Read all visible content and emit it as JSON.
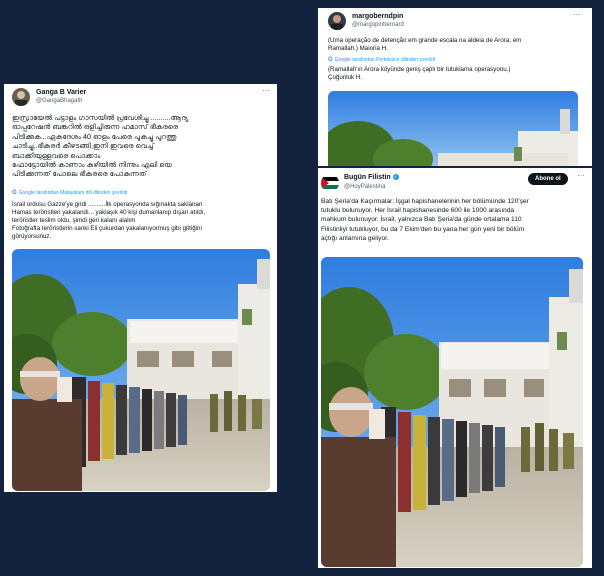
{
  "card_left": {
    "display_name": "Ganga B Varier",
    "handle": "@GangaBhagath",
    "more_icon": "more-icon",
    "tweet_text": "ഇസ്രായേൽ പട്ടാളം ഗാസയിൽ പ്രവേശിച്ചു ..........ആദ്യ\nഓപ്പറേഷൻ ബങ്കറിൽ ഒളിച്ചിരുന്ന ഹമാസ് ഭീകരരെ\nപിടിക്കുക...ഏകദേശം 40 ഓളം പേരെ പുകച്ചു പുറത്തു\nചാടിച്ചു..ഭീകരർ കീഴടങ്ങി,ഇനി ഇവരെ വെച്ച്\nബാക്കിയുള്ളവരെ പൊക്കാം\nഫോട്ടോയിൽ കാണാം കുഴിയിൽ നിന്നും എലി യെ\nപിടിക്കുന്നത് പോലെ ഭീകരരെ പോകുന്നത്",
    "translate_label": "tarafından Malayalam dili dilinden çevrildi",
    "translation": "İsrail ordusu Gazze'ye girdi ..........İlk operasyonda sığınakta saklanan\nHamas teröristleri yakalandı... yaklaşık 40 kişi dumanlanıp dışarı atıldı,\nteröristler teslim oldu, şimdi geri kalanı alalım\nFotoğrafta teröristlerin sanki Eli çukurdan yakalanıyormuş gibi gittiğini\ngörüyorsunuz."
  },
  "card_top_right": {
    "display_name": "margoberndpin",
    "handle": "@margopinbernard",
    "more_icon": "more-icon",
    "tweet_text": "(Uma operação de detenção em grande escala na aldeia de Arora, em\nRamallah.) Maioria H.",
    "translate_label": "tarafından Portekizce dilinden çevrildi",
    "translation": "(Ramallah'ın Arora köyünde geniş çaplı bir tutuklama operasyonu.)\nÇoğunluk H."
  },
  "card_bottom_right": {
    "display_name": "Bugün Filistin",
    "handle": "@HoyPalestina",
    "follow_label": "Abone ol",
    "more_icon": "more-icon",
    "verified_icon": "verified-icon",
    "tweet_text": "Batı Şeria'da Kaçırmalar: İşgal hapishanelerinin her bölümünde 120'şer\ntutuklu bulunuyor. Her İsrail hapishanesinde 600 ile 1000 arasında\nmahkum bulunuyor. İsrail, yalnızca Batı Şeria'da günde ortalama 110\nFilistinliyi tutukluyor, bu da 7 Ekim'den bu yana her gün yeni bir bölüm\naçtığı anlamına geliyor."
  },
  "colors": {
    "background": "#13233d",
    "link": "#1d9bf0",
    "google_blue": "#4285f4"
  }
}
